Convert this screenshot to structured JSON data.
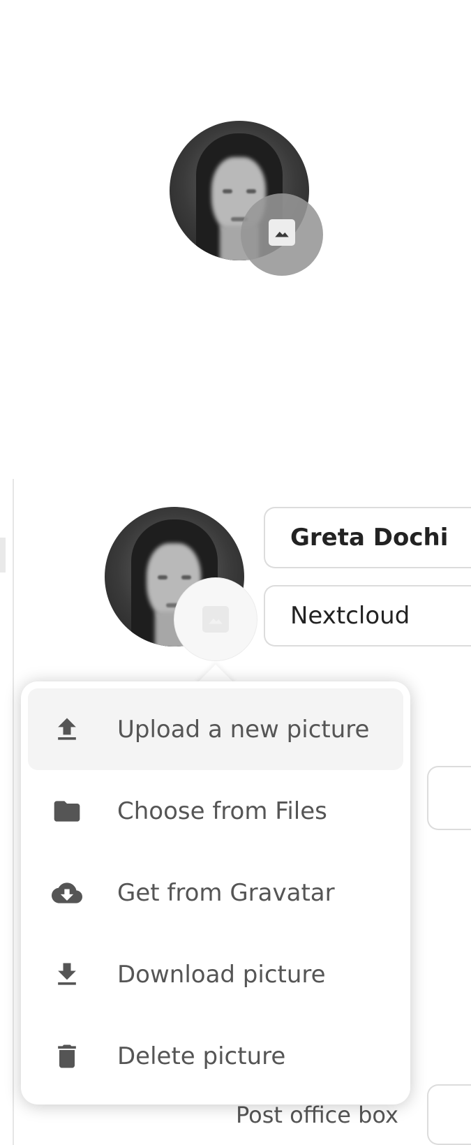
{
  "preview": {
    "avatar_icon": "user-photo",
    "badge_icon": "image-icon"
  },
  "profile": {
    "display_name": "Greta Dochi",
    "organisation": "Nextcloud",
    "post_office_box_label": "Post office box"
  },
  "avatar_menu": {
    "items": [
      {
        "label": "Upload a new picture",
        "icon": "upload-icon",
        "active": true
      },
      {
        "label": "Choose from Files",
        "icon": "folder-icon"
      },
      {
        "label": "Get from Gravatar",
        "icon": "cloud-download-icon"
      },
      {
        "label": "Download picture",
        "icon": "download-icon"
      },
      {
        "label": "Delete picture",
        "icon": "trash-icon"
      }
    ]
  },
  "colors": {
    "menu_text": "#555555",
    "active_bg": "#f4f4f4",
    "field_border": "#dcdcdc"
  }
}
